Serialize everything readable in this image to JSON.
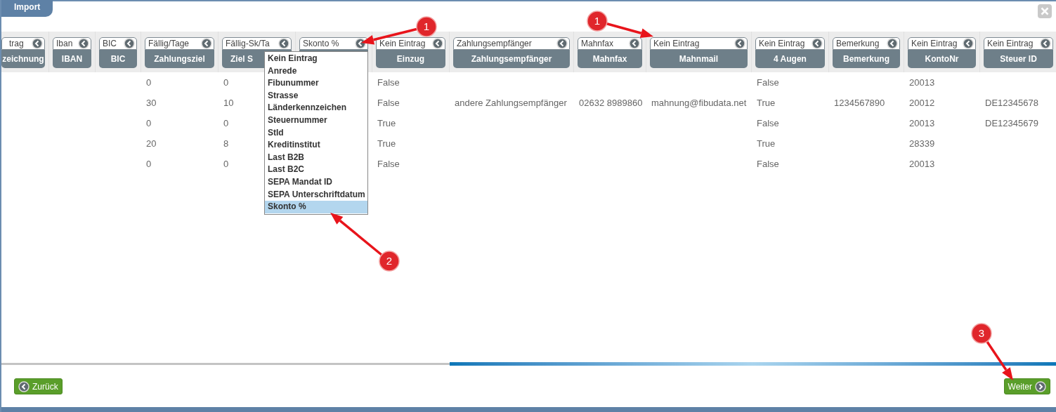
{
  "tab": {
    "label": "Import"
  },
  "columns": [
    {
      "mapping": "trag",
      "header": "zeichnung"
    },
    {
      "mapping": "Iban",
      "header": "IBAN"
    },
    {
      "mapping": "BIC",
      "header": "BIC"
    },
    {
      "mapping": "Fällig/Tage",
      "header": "Zahlungsziel"
    },
    {
      "mapping": "Fällig-Sk/Ta",
      "header": "Ziel S"
    },
    {
      "mapping": "Skonto %"
    },
    {
      "mapping": "Kein Eintrag",
      "header": "Einzug"
    },
    {
      "mapping": "Zahlungsempfänger",
      "header": "Zahlungsempfänger"
    },
    {
      "mapping": "Mahnfax",
      "header": "Mahnfax"
    },
    {
      "mapping": "Kein Eintrag",
      "header": "Mahnmail"
    },
    {
      "mapping": "Kein Eintrag",
      "header": "4 Augen"
    },
    {
      "mapping": "Bemerkung",
      "header": "Bemerkung"
    },
    {
      "mapping": "Kein Eintrag",
      "header": "KontoNr"
    },
    {
      "mapping": "Kein Eintrag",
      "header": "Steuer ID"
    }
  ],
  "rows": [
    {
      "cells": [
        null,
        null,
        null,
        "0",
        "0",
        null,
        "False",
        null,
        null,
        null,
        "False",
        null,
        "20013",
        null
      ]
    },
    {
      "cells": [
        null,
        null,
        null,
        "30",
        "10",
        null,
        "False",
        "andere Zahlungsempfänger",
        "02632 8989860",
        "mahnung@fibudata.net",
        "True",
        "1234567890",
        "20012",
        "DE12345678"
      ]
    },
    {
      "cells": [
        null,
        null,
        null,
        "0",
        "0",
        null,
        "True",
        null,
        null,
        null,
        "False",
        null,
        "20013",
        "DE12345679"
      ]
    },
    {
      "cells": [
        null,
        null,
        null,
        "20",
        "8",
        null,
        "True",
        null,
        null,
        null,
        "True",
        null,
        "28339",
        null
      ]
    },
    {
      "cells": [
        null,
        null,
        null,
        "0",
        "0",
        null,
        "False",
        null,
        null,
        null,
        "False",
        null,
        "20013",
        null
      ]
    }
  ],
  "dropdown": {
    "items": [
      {
        "label": "Kein Eintrag",
        "selected": false
      },
      {
        "label": "Anrede",
        "selected": false
      },
      {
        "label": "Fibunummer",
        "selected": false
      },
      {
        "label": "Strasse",
        "selected": false
      },
      {
        "label": "Länderkennzeichen",
        "selected": false
      },
      {
        "label": "Steuernummer",
        "selected": false
      },
      {
        "label": "StId",
        "selected": false
      },
      {
        "label": "Kreditinstitut",
        "selected": false
      },
      {
        "label": "Last B2B",
        "selected": false
      },
      {
        "label": "Last B2C",
        "selected": false
      },
      {
        "label": "SEPA Mandat ID",
        "selected": false
      },
      {
        "label": "SEPA Unterschriftdatum",
        "selected": false
      },
      {
        "label": "Skonto %",
        "selected": true
      }
    ]
  },
  "callouts": [
    {
      "number": "1"
    },
    {
      "number": "1"
    },
    {
      "number": "2"
    },
    {
      "number": "3"
    }
  ],
  "buttons": {
    "back": "Zurück",
    "next": "Weiter"
  }
}
